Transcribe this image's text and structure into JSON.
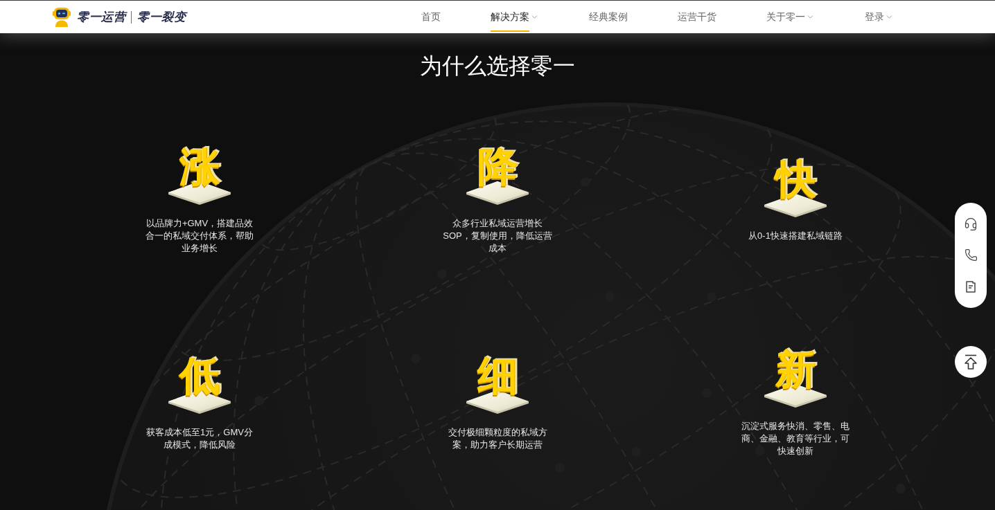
{
  "header": {
    "logo": {
      "primary": "零一运营",
      "secondary": "零一裂变"
    },
    "nav": [
      {
        "label": "首页",
        "selected": false,
        "has_menu": false
      },
      {
        "label": "解决方案",
        "selected": true,
        "has_menu": true
      },
      {
        "label": "经典案例",
        "selected": false,
        "has_menu": false
      },
      {
        "label": "运营干货",
        "selected": false,
        "has_menu": false
      },
      {
        "label": "关于零一",
        "selected": false,
        "has_menu": true
      },
      {
        "label": "登录",
        "selected": false,
        "has_menu": true
      }
    ]
  },
  "section": {
    "title": "为什么选择零一",
    "features": [
      {
        "character": "涨",
        "description": "以品牌力+GMV，搭建品效合一的私域交付体系，帮助业务增长"
      },
      {
        "character": "降",
        "description": "众多行业私域运营增长SOP，复制使用，降低运营成本"
      },
      {
        "character": "快",
        "description": "从0-1快速搭建私域链路"
      },
      {
        "character": "低",
        "description": "获客成本低至1元，GMV分成模式，降低风险"
      },
      {
        "character": "细",
        "description": "交付极细颗粒度的私域方案，助力客户长期运营"
      },
      {
        "character": "新",
        "description": "沉淀式服务快消、零售、电商、金融、教育等行业，可快速创新"
      }
    ]
  }
}
